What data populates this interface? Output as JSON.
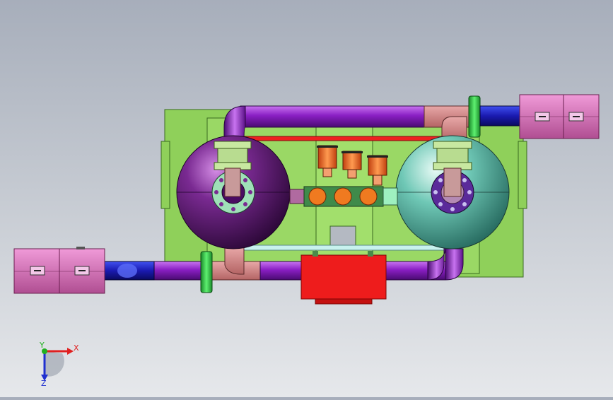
{
  "viewport": {
    "background_top": "#a7aebb",
    "background_bottom": "#e6e8eb"
  },
  "axis_triad": {
    "x_label": "X",
    "y_label": "Y",
    "z_label": "Z",
    "x_color": "#e02020",
    "y_color": "#20b020",
    "z_color": "#2030d0"
  },
  "model": {
    "frame_color": "#8fd05a",
    "vessel_left_color": "#5a1a6e",
    "vessel_right_color": "#3c9a8a",
    "pipe_color": "#8a1fc4",
    "flange_color": "#2ecc40",
    "valve_color": "#f06a20",
    "motor_color": "#ee1c1c",
    "terminal_box_color": "#e070c8",
    "icons": [
      "vessel-left-icon",
      "vessel-right-icon",
      "pump-motor-icon",
      "valve-icon",
      "terminal-box-icon"
    ]
  }
}
